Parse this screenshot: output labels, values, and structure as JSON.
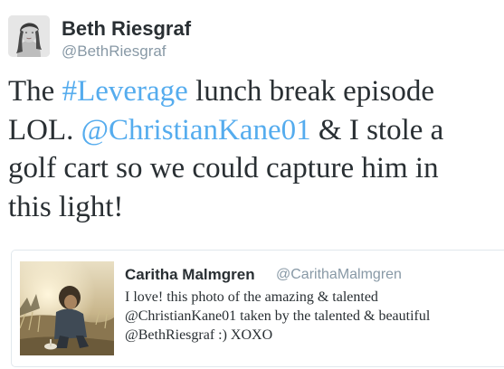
{
  "author": {
    "name": "Beth Riesgraf",
    "handle": "@BethRiesgraf"
  },
  "tweet": {
    "line1_a": "The ",
    "hashtag": "#Leverage",
    "line1_b": " lunch break episode",
    "line2_a": "LOL. ",
    "mention": "@ChristianKane01",
    "line2_b": " & I stole a",
    "line3": "golf cart so we could capture him in",
    "line4": "this light!"
  },
  "quote": {
    "name": "Caritha Malmgren",
    "handle": "@CarithaMalmgren",
    "line1": "I love! this photo of the amazing & talented",
    "line2": "@ChristianKane01 taken by the talented & beautiful",
    "line3": "@BethRiesgraf :) XOXO"
  },
  "colors": {
    "link": "#55acee",
    "text": "#292f33",
    "muted": "#8899a6",
    "border": "#e1e8ed"
  },
  "icons": {
    "author_avatar": "profile-photo",
    "quote_photo": "photo-thumbnail"
  }
}
